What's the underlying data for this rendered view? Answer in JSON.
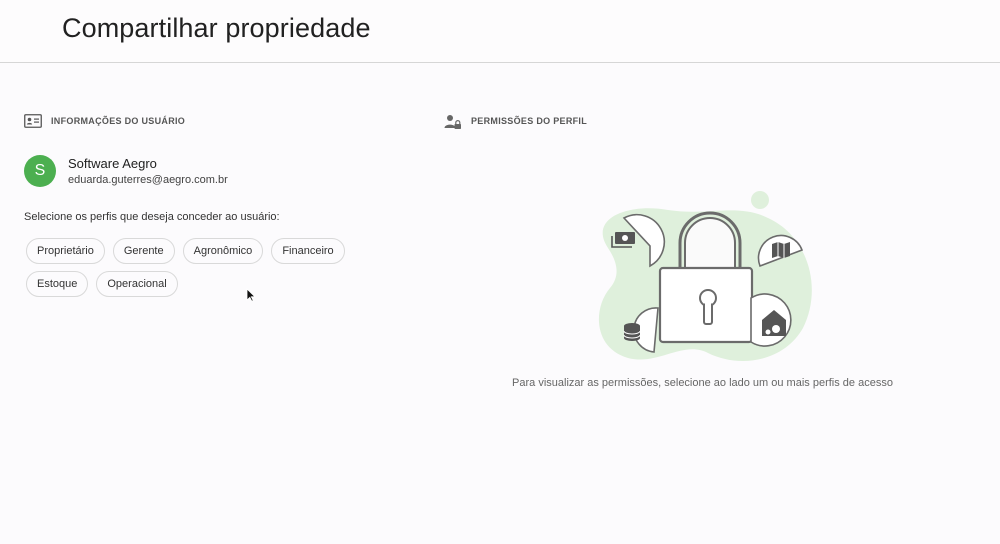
{
  "header": {
    "title": "Compartilhar propriedade"
  },
  "user_info": {
    "section_title": "INFORMAÇÕES DO USUÁRIO",
    "section_icon": "id-card-icon",
    "avatar_letter": "S",
    "avatar_color": "#4caf50",
    "name": "Software Aegro",
    "email": "eduarda.guterres@aegro.com.br",
    "instruction": "Selecione os perfis que deseja conceder ao usuário:",
    "profiles_row1": [
      "Proprietário",
      "Gerente",
      "Agronômico",
      "Financeiro"
    ],
    "profiles_row2": [
      "Estoque",
      "Operacional"
    ]
  },
  "permissions": {
    "section_title": "PERMISSÕES DO PERFIL",
    "section_icon": "user-lock-icon",
    "empty_message": "Para visualizar as permissões, selecione ao lado um ou mais perfis de acesso",
    "illustration_icons": [
      "padlock-icon",
      "money-icon",
      "map-icon",
      "database-icon",
      "barn-tractor-icon"
    ],
    "accent_color": "#dff0dc"
  }
}
